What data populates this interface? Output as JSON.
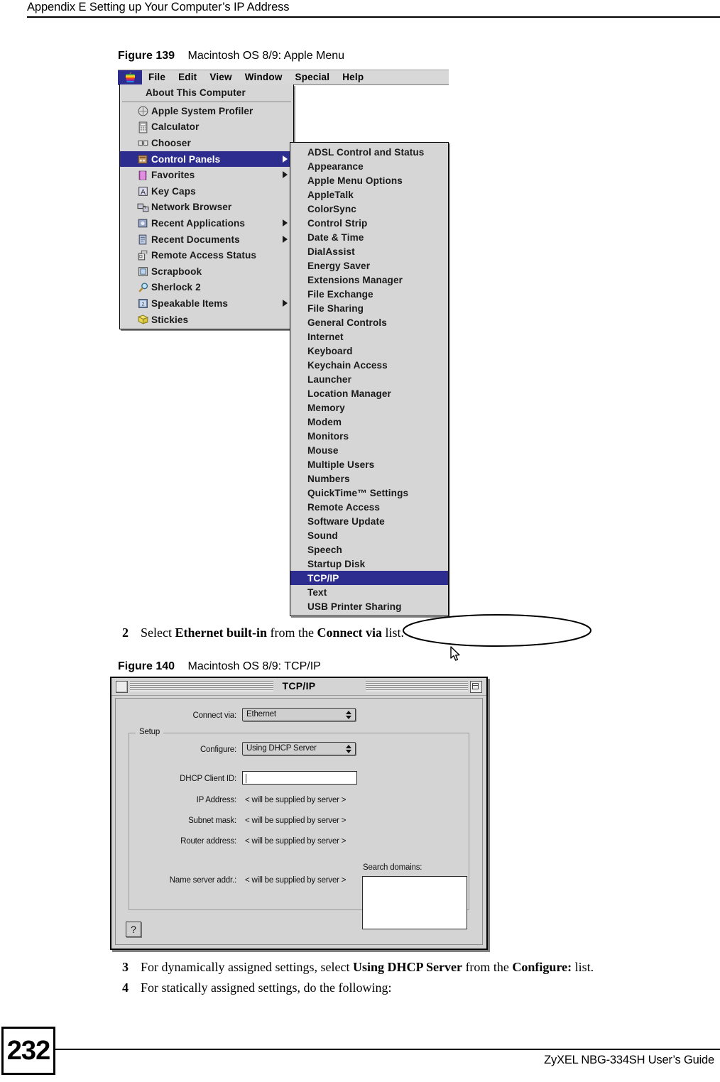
{
  "page": {
    "header_title": "Appendix E Setting up Your Computer’s IP Address",
    "page_number": "232",
    "footer_guide": "ZyXEL NBG-334SH User’s Guide"
  },
  "figure139": {
    "caption_number": "Figure 139",
    "caption_text": "Macintosh OS 8/9: Apple Menu",
    "menubar": {
      "apple_icon": "apple-logo-icon",
      "items": [
        "File",
        "Edit",
        "View",
        "Window",
        "Special",
        "Help"
      ]
    },
    "apple_menu": {
      "first_item": "About This Computer",
      "items": [
        {
          "label": "Apple System Profiler",
          "icon": "apple-system-profiler-icon",
          "submenu": false,
          "selected": false
        },
        {
          "label": "Calculator",
          "icon": "calculator-icon",
          "submenu": false,
          "selected": false
        },
        {
          "label": "Chooser",
          "icon": "chooser-icon",
          "submenu": false,
          "selected": false
        },
        {
          "label": "Control Panels",
          "icon": "control-panels-icon",
          "submenu": true,
          "selected": true
        },
        {
          "label": "Favorites",
          "icon": "favorites-folder-icon",
          "submenu": true,
          "selected": false
        },
        {
          "label": "Key Caps",
          "icon": "key-caps-icon",
          "submenu": false,
          "selected": false
        },
        {
          "label": "Network Browser",
          "icon": "network-browser-icon",
          "submenu": false,
          "selected": false
        },
        {
          "label": "Recent Applications",
          "icon": "recent-applications-icon",
          "submenu": true,
          "selected": false
        },
        {
          "label": "Recent Documents",
          "icon": "recent-documents-icon",
          "submenu": true,
          "selected": false
        },
        {
          "label": "Remote Access Status",
          "icon": "remote-access-status-icon",
          "submenu": false,
          "selected": false
        },
        {
          "label": "Scrapbook",
          "icon": "scrapbook-icon",
          "submenu": false,
          "selected": false
        },
        {
          "label": "Sherlock 2",
          "icon": "sherlock-magnifier-icon",
          "submenu": false,
          "selected": false
        },
        {
          "label": "Speakable Items",
          "icon": "speakable-items-icon",
          "submenu": true,
          "selected": false
        },
        {
          "label": "Stickies",
          "icon": "stickies-icon",
          "submenu": false,
          "selected": false
        }
      ]
    },
    "control_panels_submenu": {
      "selected": "TCP/IP",
      "items": [
        "ADSL Control and Status",
        "Appearance",
        "Apple Menu Options",
        "AppleTalk",
        "ColorSync",
        "Control Strip",
        "Date & Time",
        "DialAssist",
        "Energy Saver",
        "Extensions Manager",
        "File Exchange",
        "File Sharing",
        "General Controls",
        "Internet",
        "Keyboard",
        "Keychain Access",
        "Launcher",
        "Location Manager",
        "Memory",
        "Modem",
        "Monitors",
        "Mouse",
        "Multiple Users",
        "Numbers",
        "QuickTime™ Settings",
        "Remote Access",
        "Software Update",
        "Sound",
        "Speech",
        "Startup Disk",
        "TCP/IP",
        "Text",
        "USB Printer Sharing"
      ]
    },
    "annotation": "highlight-ellipse",
    "cursor": "arrow-cursor"
  },
  "step2": {
    "number": "2",
    "prefix": "Select ",
    "bold1": "Ethernet built-in",
    "middle": " from the ",
    "bold2": "Connect via",
    "suffix": " list."
  },
  "figure140": {
    "caption_number": "Figure 140",
    "caption_text": "Macintosh OS 8/9: TCP/IP",
    "window": {
      "title": "TCP/IP",
      "close_button": "close-box",
      "zoom_button": "zoom-box",
      "connect_via_label": "Connect via:",
      "connect_via_value": "Ethernet",
      "setup_group_title": "Setup",
      "configure_label": "Configure:",
      "configure_value": "Using DHCP Server",
      "dhcp_client_id_label": "DHCP Client ID:",
      "dhcp_client_id_value": "",
      "ip_address_label": "IP Address:",
      "ip_address_value": "< will be supplied by server >",
      "subnet_mask_label": "Subnet mask:",
      "subnet_mask_value": "< will be supplied by server >",
      "router_address_label": "Router address:",
      "router_address_value": "< will be supplied by server >",
      "name_server_label": "Name server addr.:",
      "name_server_value": "< will be supplied by server >",
      "search_domains_label": "Search domains:",
      "search_domains_value": "",
      "help_button": "?"
    }
  },
  "step3": {
    "number": "3",
    "prefix": "For dynamically assigned settings, select ",
    "bold1": "Using DHCP Server",
    "middle": " from the ",
    "bold2": "Configure:",
    "suffix": " list."
  },
  "step4": {
    "number": "4",
    "text": "For statically assigned settings, do the following:"
  }
}
